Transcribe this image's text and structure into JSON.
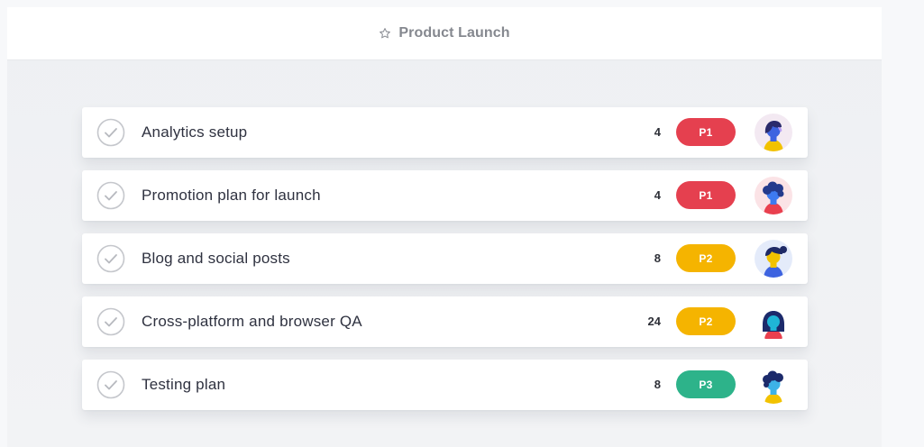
{
  "header": {
    "title": "Product Launch",
    "star_icon": "star-outline-icon"
  },
  "tasks": [
    {
      "label": "Analytics setup",
      "count": "4",
      "priority": "P1",
      "priority_color": "#e5404f"
    },
    {
      "label": "Promotion plan for launch",
      "count": "4",
      "priority": "P1",
      "priority_color": "#e5404f"
    },
    {
      "label": "Blog and social posts",
      "count": "8",
      "priority": "P2",
      "priority_color": "#f5b400"
    },
    {
      "label": "Cross-platform and browser QA",
      "count": "24",
      "priority": "P2",
      "priority_color": "#f5b400"
    },
    {
      "label": "Testing plan",
      "count": "8",
      "priority": "P3",
      "priority_color": "#2db38a"
    }
  ]
}
